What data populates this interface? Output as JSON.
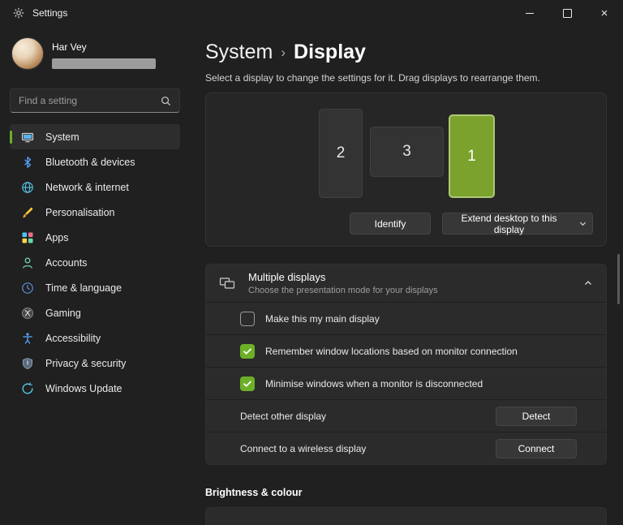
{
  "window": {
    "title": "Settings"
  },
  "sidebar": {
    "user_name": "Har Vey",
    "search_placeholder": "Find a setting",
    "items": [
      {
        "label": "System",
        "icon": "system-icon",
        "selected": true
      },
      {
        "label": "Bluetooth & devices",
        "icon": "bluetooth-icon",
        "selected": false
      },
      {
        "label": "Network & internet",
        "icon": "globe-icon",
        "selected": false
      },
      {
        "label": "Personalisation",
        "icon": "brush-icon",
        "selected": false
      },
      {
        "label": "Apps",
        "icon": "apps-grid-icon",
        "selected": false
      },
      {
        "label": "Accounts",
        "icon": "person-icon",
        "selected": false
      },
      {
        "label": "Time & language",
        "icon": "clock-icon",
        "selected": false
      },
      {
        "label": "Gaming",
        "icon": "xbox-icon",
        "selected": false
      },
      {
        "label": "Accessibility",
        "icon": "accessibility-icon",
        "selected": false
      },
      {
        "label": "Privacy & security",
        "icon": "shield-icon",
        "selected": false
      },
      {
        "label": "Windows Update",
        "icon": "update-icon",
        "selected": false
      }
    ]
  },
  "header": {
    "breadcrumb_parent": "System",
    "breadcrumb_separator": "›",
    "title": "Display",
    "description": "Select a display to change the settings for it. Drag displays to rearrange them."
  },
  "display_panel": {
    "monitors": [
      {
        "id": "2",
        "selected": false
      },
      {
        "id": "3",
        "selected": false
      },
      {
        "id": "1",
        "selected": true
      }
    ],
    "identify_label": "Identify",
    "extend_label": "Extend desktop to this display"
  },
  "multiple_displays": {
    "title": "Multiple displays",
    "subtitle": "Choose the presentation mode for your displays",
    "checkboxes": [
      {
        "label": "Make this my main display",
        "checked": false
      },
      {
        "label": "Remember window locations based on monitor connection",
        "checked": true
      },
      {
        "label": "Minimise windows when a monitor is disconnected",
        "checked": true
      }
    ],
    "actions": [
      {
        "label": "Detect other display",
        "button": "Detect"
      },
      {
        "label": "Connect to a wireless display",
        "button": "Connect"
      }
    ]
  },
  "sections": {
    "brightness_heading": "Brightness & colour"
  },
  "colors": {
    "accent_green": "#6cb028",
    "display_green": "#7ba22d",
    "display_green_border": "#aec775"
  }
}
